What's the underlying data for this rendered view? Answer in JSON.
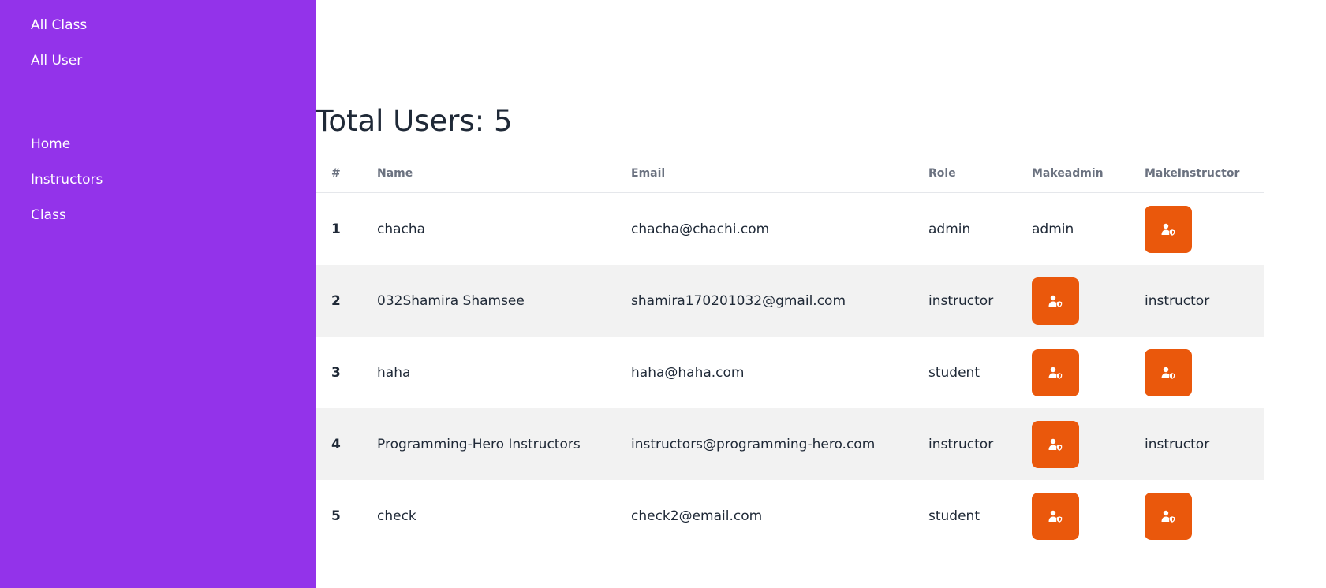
{
  "sidebar": {
    "top_items": [
      {
        "label": "All Class"
      },
      {
        "label": "All User"
      }
    ],
    "bottom_items": [
      {
        "label": "Home"
      },
      {
        "label": "Instructors"
      },
      {
        "label": "Class"
      }
    ]
  },
  "page": {
    "title": "Total Users: 5"
  },
  "table": {
    "headers": {
      "num": "#",
      "name": "Name",
      "email": "Email",
      "role": "Role",
      "make_admin": "Makeadmin",
      "make_instructor": "MakeInstructor"
    },
    "rows": [
      {
        "num": "1",
        "name": "chacha",
        "email": "chacha@chachi.com",
        "role": "admin",
        "make_admin": "admin",
        "make_instructor": null
      },
      {
        "num": "2",
        "name": "032Shamira Shamsee",
        "email": "shamira170201032@gmail.com",
        "role": "instructor",
        "make_admin": null,
        "make_instructor": "instructor"
      },
      {
        "num": "3",
        "name": "haha",
        "email": "haha@haha.com",
        "role": "student",
        "make_admin": null,
        "make_instructor": null
      },
      {
        "num": "4",
        "name": "Programming-Hero Instructors",
        "email": "instructors@programming-hero.com",
        "role": "instructor",
        "make_admin": null,
        "make_instructor": "instructor"
      },
      {
        "num": "5",
        "name": "check",
        "email": "check2@email.com",
        "role": "student",
        "make_admin": null,
        "make_instructor": null
      }
    ]
  },
  "icons": {
    "action_button": "user-shield-icon"
  },
  "colors": {
    "sidebar_bg": "#9333ea",
    "action_button": "#ea580c",
    "alt_row": "#f2f2f2"
  }
}
